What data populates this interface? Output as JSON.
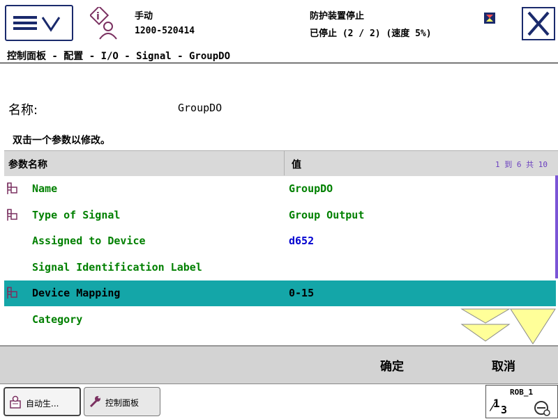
{
  "header": {
    "mode": "手动",
    "system_id": "1200-520414",
    "safety_status": "防护装置停止",
    "run_status": "已停止 (2 / 2) (速度 5%)"
  },
  "breadcrumb": "控制面板 - 配置 - I/O - Signal - GroupDO",
  "title": {
    "label": "名称:",
    "value": "GroupDO"
  },
  "hint": "双击一个参数以修改。",
  "table": {
    "col_name": "参数名称",
    "col_value": "值",
    "pager": "1 到 6 共 10",
    "rows": [
      {
        "name": "Name",
        "value": "GroupDO",
        "icon": true,
        "selected": false,
        "value_color": "#008000"
      },
      {
        "name": "Type of Signal",
        "value": "Group Output",
        "icon": true,
        "selected": false,
        "value_color": "#008000"
      },
      {
        "name": "Assigned to Device",
        "value": "d652",
        "icon": false,
        "selected": false,
        "value_color": "#0000d0"
      },
      {
        "name": "Signal Identification Label",
        "value": "",
        "icon": false,
        "selected": false,
        "value_color": "#008000"
      },
      {
        "name": "Device Mapping",
        "value": "0-15",
        "icon": true,
        "selected": true,
        "value_color": "#000000"
      },
      {
        "name": "Category",
        "value": "",
        "icon": false,
        "selected": false,
        "value_color": "#008000"
      }
    ]
  },
  "actions": {
    "ok": "确定",
    "cancel": "取消"
  },
  "taskbar": {
    "task1": "自动生...",
    "task2": "控制面板",
    "robot": "ROB_1",
    "fraction_num": "1",
    "fraction_den": "3"
  },
  "colors": {
    "selection": "#14a6a8",
    "param_text": "#008000",
    "device_link": "#0000d0",
    "scroll_arrow": "#ffff99"
  }
}
